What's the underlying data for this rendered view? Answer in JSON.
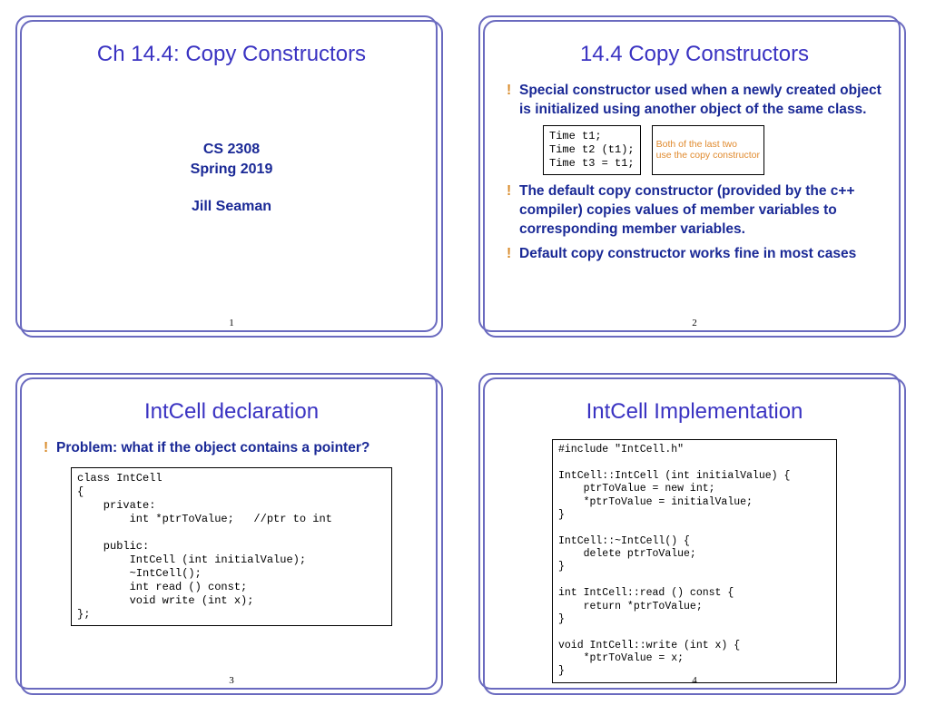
{
  "slide1": {
    "title": "Ch 14.4: Copy Constructors",
    "course": "CS 2308",
    "term": "Spring 2019",
    "author": "Jill Seaman",
    "page": "1"
  },
  "slide2": {
    "title": "14.4 Copy Constructors",
    "b1_a": "Special constructor used when a newly created object is ",
    "b1_b": "initialized",
    "b1_c": " using another object of the ",
    "b1_d": "same class",
    "b1_e": ".",
    "code": "Time t1;\nTime t2 (t1);\nTime t3 = t1;",
    "note1": "Both of the last two",
    "note2": "use the copy constructor",
    "b2_a": "The ",
    "b2_b": "default copy constructor",
    "b2_c": " (provided by the c++ compiler) copies values of member variables to corresponding member variables.",
    "b3": "Default copy constructor works fine in most cases",
    "page": "2"
  },
  "slide3": {
    "title": "IntCell declaration",
    "b1": "Problem: what if the object contains a pointer?",
    "code": "class IntCell\n{\n    private:\n        int *ptrToValue;   //ptr to int\n\n    public:\n        IntCell (int initialValue);\n        ~IntCell();\n        int read () const;\n        void write (int x);\n};",
    "page": "3"
  },
  "slide4": {
    "title": "IntCell Implementation",
    "code": "#include \"IntCell.h\"\n\nIntCell::IntCell (int initialValue) {\n    ptrToValue = new int;\n    *ptrToValue = initialValue;\n}\n\nIntCell::~IntCell() {\n    delete ptrToValue;\n}\n\nint IntCell::read () const {\n    return *ptrToValue;\n}\n\nvoid IntCell::write (int x) {\n    *ptrToValue = x;\n}",
    "page": "4"
  }
}
